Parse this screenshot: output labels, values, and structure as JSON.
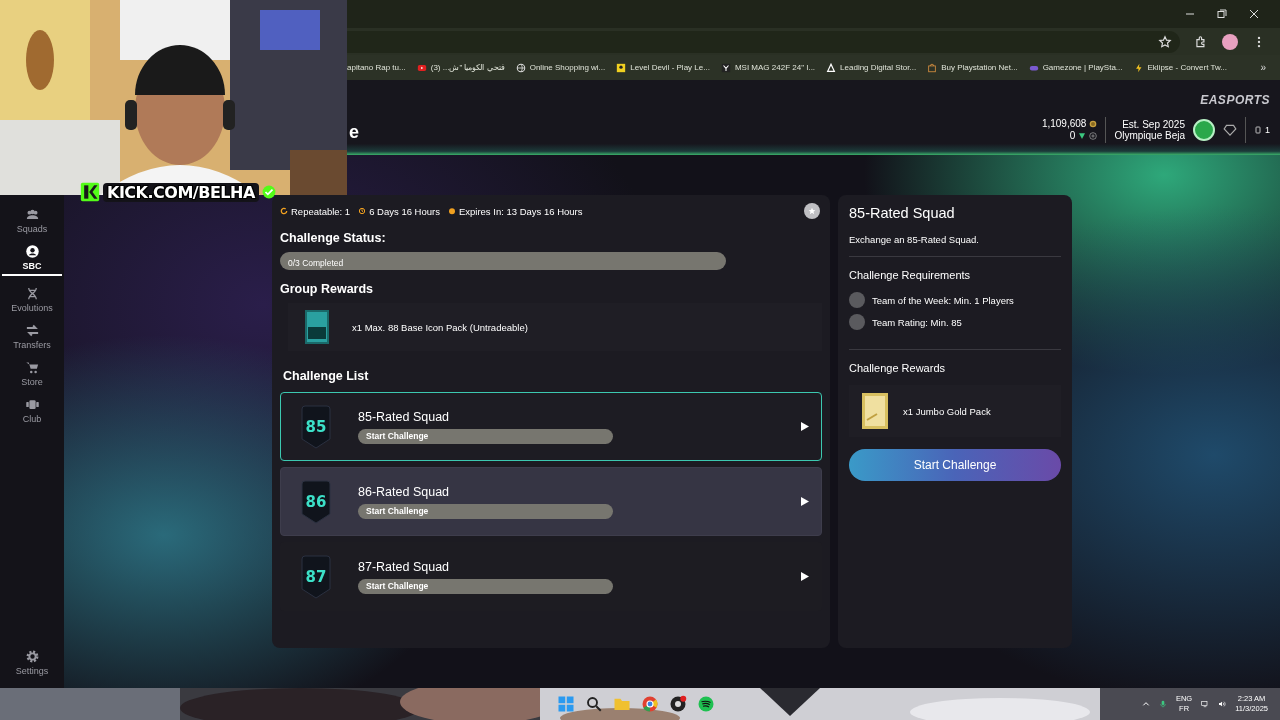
{
  "browser": {
    "bookmarks": [
      {
        "label": "apitano Rap tu..."
      },
      {
        "label": "فتحي الكوميا \"ش... (3)"
      },
      {
        "label": "Online Shopping wi..."
      },
      {
        "label": "Level Devil - Play Le..."
      },
      {
        "label": "MSI MAG 242F 24\" I..."
      },
      {
        "label": "Leading Digital Stor..."
      },
      {
        "label": "Buy Playstation Net..."
      },
      {
        "label": "Gamezone | PlaySta..."
      },
      {
        "label": "Eklipse - Convert Tw..."
      }
    ],
    "more_bookmarks": "»"
  },
  "stream_overlay": {
    "channel": "KICK.COM/BELHA"
  },
  "header": {
    "title": "e",
    "brand": "EASPORTS",
    "coins": "1,109,608",
    "points": "0",
    "club_est": "Est. Sep 2025",
    "club_name": "Olympique Beja",
    "notifications": "1"
  },
  "sidebar": {
    "items": [
      {
        "label": "Squads",
        "selected": false
      },
      {
        "label": "SBC",
        "selected": true
      },
      {
        "label": "Evolutions",
        "selected": false
      },
      {
        "label": "Transfers",
        "selected": false
      },
      {
        "label": "Store",
        "selected": false
      },
      {
        "label": "Club",
        "selected": false
      }
    ],
    "footer": {
      "label": "Settings"
    }
  },
  "challenge_group": {
    "meta": [
      {
        "text": "Repeatable: 1"
      },
      {
        "text": "6 Days 16 Hours"
      },
      {
        "text": "Expires In: 13 Days 16 Hours"
      }
    ],
    "status_heading": "Challenge Status:",
    "progress": {
      "label": "0/3 Completed",
      "level": 0
    },
    "rewards_heading": "Group Rewards",
    "rewards": [
      {
        "label": "x1 Max. 88 Base Icon Pack (Untradeable)"
      }
    ],
    "list_heading": "Challenge List",
    "challenges": [
      {
        "rating": "85",
        "title": "85-Rated Squad",
        "action": "Start Challenge",
        "selected": true,
        "hovered": false
      },
      {
        "rating": "86",
        "title": "86-Rated Squad",
        "action": "Start Challenge",
        "selected": false,
        "hovered": true
      },
      {
        "rating": "87",
        "title": "87-Rated Squad",
        "action": "Start Challenge",
        "selected": false,
        "hovered": false
      }
    ]
  },
  "detail": {
    "title": "85-Rated Squad",
    "description": "Exchange an 85-Rated Squad.",
    "requirements_heading": "Challenge Requirements",
    "requirements": [
      {
        "text": "Team of the Week: Min. 1 Players",
        "met": false
      },
      {
        "text": "Team Rating: Min. 85",
        "met": false
      }
    ],
    "rewards_heading": "Challenge Rewards",
    "rewards": [
      {
        "label": "x1 Jumbo Gold Pack"
      }
    ],
    "button": "Start Challenge"
  },
  "taskbar": {
    "language": "ENG",
    "layout": "FR",
    "time": "2:23 AM",
    "date": "11/3/2025"
  }
}
